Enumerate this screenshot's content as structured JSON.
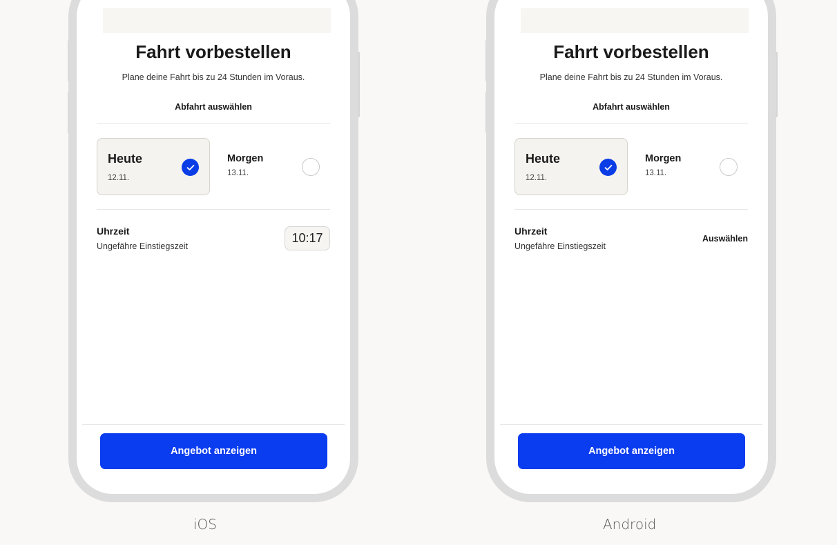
{
  "ios": {
    "title": "Fahrt vorbestellen",
    "subtitle": "Plane deine Fahrt bis zu 24 Stunden im Voraus.",
    "section_label": "Abfahrt auswählen",
    "today": {
      "label": "Heute",
      "date": "12.11.",
      "selected": true
    },
    "tomorrow": {
      "label": "Morgen",
      "date": "13.11.",
      "selected": false
    },
    "time": {
      "label": "Uhrzeit",
      "sublabel": "Ungefähre Einstiegszeit",
      "value": "10:17"
    },
    "cta_label": "Angebot anzeigen",
    "platform": "iOS"
  },
  "android": {
    "title": "Fahrt vorbestellen",
    "subtitle": "Plane deine Fahrt bis zu 24 Stunden im Voraus.",
    "section_label": "Abfahrt auswählen",
    "today": {
      "label": "Heute",
      "date": "12.11.",
      "selected": true
    },
    "tomorrow": {
      "label": "Morgen",
      "date": "13.11.",
      "selected": false
    },
    "time": {
      "label": "Uhrzeit",
      "sublabel": "Ungefähre Einstiegszeit",
      "action": "Auswählen"
    },
    "cta_label": "Angebot anzeigen",
    "platform": "Android"
  },
  "colors": {
    "accent": "#0a3cf0",
    "card_bg": "#f5f3ef",
    "frame": "#dcdcdc"
  },
  "icons": {
    "selected": "check-icon",
    "unselected": "radio-empty-icon"
  }
}
